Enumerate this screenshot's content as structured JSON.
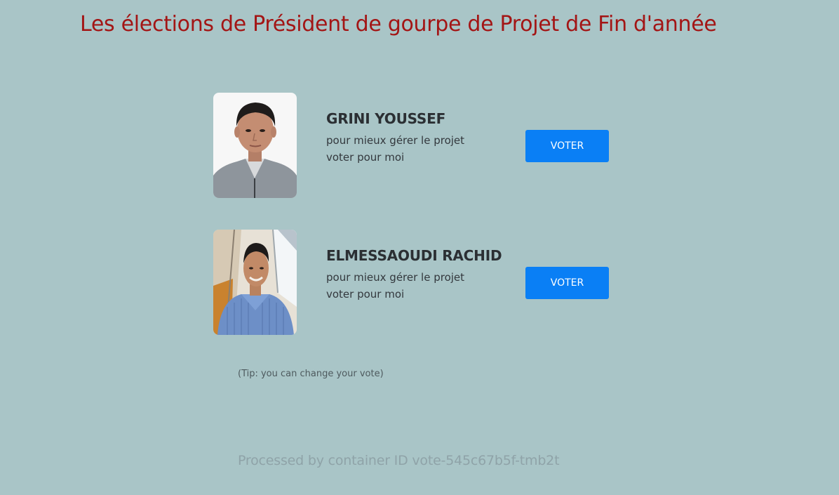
{
  "page": {
    "title": "Les élections de Président de gourpe de Projet de Fin d'année",
    "background_color": "#a9c5c7",
    "title_color": "#a31515",
    "button_color": "#0a7ff5"
  },
  "candidates": [
    {
      "name": "GRINI YOUSSEF",
      "description_line1": "pour mieux gérer le projet",
      "description_line2": "voter pour moi",
      "button_label": "VOTER",
      "photo": "candidate-photo-portrait-white-background"
    },
    {
      "name": "ELMESSAOUDI RACHID",
      "description_line1": "pour mieux gérer le projet",
      "description_line2": "voter pour moi",
      "button_label": "VOTER",
      "photo": "candidate-photo-selfie-blue-shirt"
    }
  ],
  "tip": "(Tip: you can change your vote)",
  "footer": "Processed by container ID vote-545c67b5f-tmb2t"
}
